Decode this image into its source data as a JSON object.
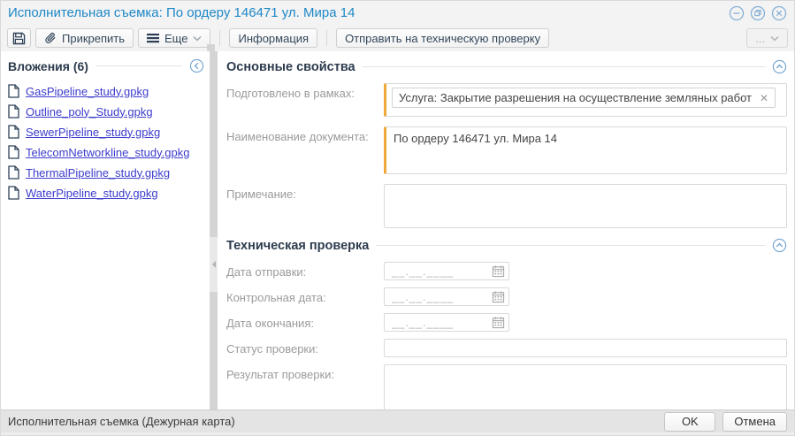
{
  "window": {
    "title": "Исполнительная съемка: По ордеру 146471 ул. Мира 14"
  },
  "toolbar": {
    "attach": "Прикрепить",
    "more": "Еще",
    "info": "Информация",
    "send_review": "Отправить на техническую проверку",
    "overflow": "..."
  },
  "sidebar": {
    "title": "Вложения (6)",
    "files": [
      "GasPipeline_study.gpkg",
      "Outline_poly_Study.gpkg",
      "SewerPipeline_study.gpkg",
      "TelecomNetworkline_study.gpkg",
      "ThermalPipeline_study.gpkg",
      "WaterPipeline_study.gpkg"
    ]
  },
  "basic": {
    "title": "Основные свойства",
    "prepared_label": "Подготовлено в рамках:",
    "prepared_tag": "Услуга: Закрытие разрешения на осуществление земляных работ",
    "remove_glyph": "✕",
    "doc_name_label": "Наименование документа:",
    "doc_name_value": "По ордеру 146471 ул. Мира 14",
    "note_label": "Примечание:"
  },
  "tech": {
    "title": "Техническая проверка",
    "send_date_label": "Дата отправки:",
    "control_date_label": "Контрольная дата:",
    "end_date_label": "Дата окончания:",
    "status_label": "Статус проверки:",
    "result_label": "Результат проверки:",
    "date_placeholder": "__.__.____"
  },
  "footer": {
    "status": "Исполнительная съемка (Дежурная карта)",
    "ok": "OK",
    "cancel": "Отмена"
  },
  "colors": {
    "title_blue": "#1e88c8",
    "accent_orange": "#f0a73c",
    "link_blue": "#3c3ccd",
    "icon_navy": "#2d4056",
    "control_blue": "#85b0d5"
  }
}
